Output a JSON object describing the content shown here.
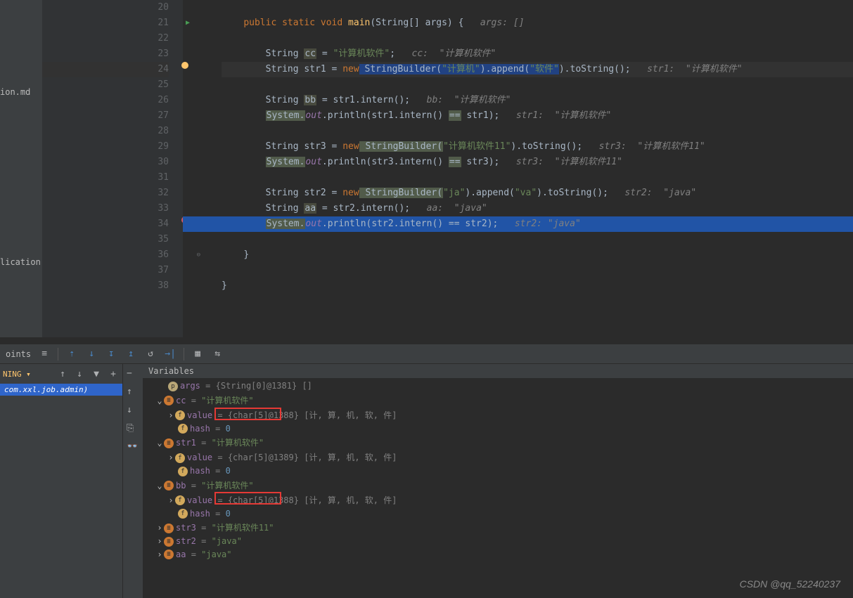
{
  "sidebar": {
    "item1": "ion.md",
    "item2": "lication"
  },
  "gutter": {
    "lines": [
      "20",
      "21",
      "22",
      "23",
      "24",
      "25",
      "26",
      "27",
      "28",
      "29",
      "30",
      "31",
      "32",
      "33",
      "34",
      "35",
      "36",
      "37",
      "38",
      ""
    ]
  },
  "code": {
    "l21_public": "public",
    "l21_static": "static",
    "l21_void": "void",
    "l21_main": "main",
    "l21_sig": "(String[] args) {",
    "l21_hint": "args: []",
    "l23_String": "String ",
    "l23_cc": "cc",
    "l23_eq": " = ",
    "l23_val": "\"计算机软件\"",
    "l23_semi": ";",
    "l23_hint": "cc:  \"计算机软件\"",
    "l24_String": "String str1 = ",
    "l24_new": "new",
    "l24_sb": " StringBuilder(",
    "l24_arg1": "\"计算机\"",
    "l24_app": ").append(",
    "l24_arg2": "\"软件\"",
    "l24_end": ").toString();",
    "l24_hint": "str1:  \"计算机软件\"",
    "l26_String": "String ",
    "l26_bb": "bb",
    "l26_rest": " = str1.intern();",
    "l26_hint": "bb:  \"计算机软件\"",
    "l27_sys": "System.",
    "l27_out": "out",
    "l27_print": ".println(str1.intern() ",
    "l27_eqeq": "==",
    "l27_str1": " str1);",
    "l27_hint": "str1:  \"计算机软件\"",
    "l29_String": "String str3 = ",
    "l29_new": "new",
    "l29_sb": " StringBuilder(",
    "l29_arg": "\"计算机软件11\"",
    "l29_end": ").toString();",
    "l29_hint": "str3:  \"计算机软件11\"",
    "l30_sys": "System.",
    "l30_out": "out",
    "l30_print": ".println(str3.intern() ",
    "l30_eqeq": "==",
    "l30_str3": " str3);",
    "l30_hint": "str3:  \"计算机软件11\"",
    "l32_String": "String str2 = ",
    "l32_new": "new",
    "l32_sb": " StringBuilder(",
    "l32_ja": "\"ja\"",
    "l32_app": ").append(",
    "l32_va": "\"va\"",
    "l32_end": ").toString();",
    "l32_hint": "str2:  \"java\"",
    "l33_String": "String ",
    "l33_aa": "aa",
    "l33_rest": " = str2.intern();",
    "l33_hint": "aa:  \"java\"",
    "l34_sys": "System.",
    "l34_out": "out",
    "l34_print": ".println(str2.intern() == str2)",
    "l34_semi": ";",
    "l34_hint": "str2: \"java\"",
    "l36_brace": "}",
    "l38_brace": "}"
  },
  "debug": {
    "tab_points": "oints",
    "running_label": "NING",
    "running_item": "com.xxl.job.admin)",
    "vars_title": "Variables",
    "rows": {
      "args_name": "args",
      "args_type": "{String[0]@1381}",
      "args_val": "[]",
      "cc_name": "cc",
      "cc_val": "\"计算机软件\"",
      "cc_value_name": "value",
      "cc_value_type": "{char[5]@1388}",
      "cc_value_arr": "[计, 算, 机, 软, 件]",
      "cc_hash_name": "hash",
      "cc_hash_val": "0",
      "str1_name": "str1",
      "str1_val": "\"计算机软件\"",
      "str1_value_name": "value",
      "str1_value_type": "{char[5]@1389}",
      "str1_value_arr": "[计, 算, 机, 软, 件]",
      "str1_hash_name": "hash",
      "str1_hash_val": "0",
      "bb_name": "bb",
      "bb_val": "\"计算机软件\"",
      "bb_value_name": "value",
      "bb_value_type": "{char[5]@1388}",
      "bb_value_arr": "[计, 算, 机, 软, 件]",
      "bb_hash_name": "hash",
      "bb_hash_val": "0",
      "str3_name": "str3",
      "str3_val": "\"计算机软件11\"",
      "str2_name": "str2",
      "str2_val": "\"java\"",
      "aa_name": "aa",
      "aa_val": "\"java\""
    }
  },
  "watermark": "CSDN @qq_52240237"
}
